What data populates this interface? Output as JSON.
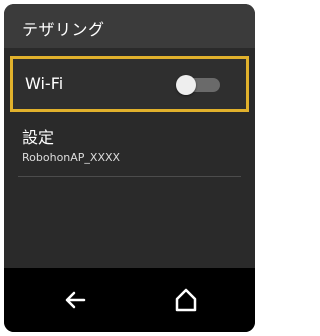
{
  "header": {
    "title": "テザリング"
  },
  "wifi": {
    "label": "Wi-Fi",
    "enabled": false
  },
  "settings": {
    "title": "設定",
    "subtitle": "RobohonAP_XXXX"
  },
  "nav": {
    "back_icon": "back-arrow-icon",
    "home_icon": "home-icon"
  },
  "colors": {
    "highlight": "#e1b12c",
    "screen": "#2a2a2a",
    "app_bar": "#3b3b3b",
    "nav_bar": "#000000"
  }
}
